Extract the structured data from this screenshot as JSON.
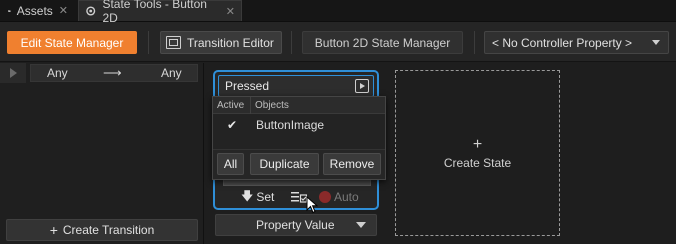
{
  "tabs": [
    {
      "label": "Assets",
      "close": "✕"
    },
    {
      "label": "State Tools - Button 2D",
      "close": "✕"
    }
  ],
  "toolbar": {
    "edit_state_manager": "Edit State Manager",
    "transition_editor": "Transition Editor",
    "state_manager_name": "Button 2D State Manager",
    "controller_property": "< No Controller Property >"
  },
  "transitions": {
    "from": "Any",
    "arrow": "⟶",
    "to": "Any",
    "create_label": "Create Transition",
    "create_plus": "+"
  },
  "state": {
    "name": "Pressed",
    "set_label": "Set",
    "set_icon": "🡇",
    "auto_label": "Auto"
  },
  "popup": {
    "col_active": "Active",
    "col_objects": "Objects",
    "rows": [
      {
        "check": "✔",
        "name": "ButtonImage"
      }
    ],
    "all_label": "All",
    "duplicate_label": "Duplicate",
    "remove_label": "Remove"
  },
  "property_value": "Property Value",
  "create_state": {
    "plus": "+",
    "label": "Create State"
  },
  "colors": {
    "accent_orange": "#f0802f",
    "selection_blue": "#2f8fd8"
  }
}
